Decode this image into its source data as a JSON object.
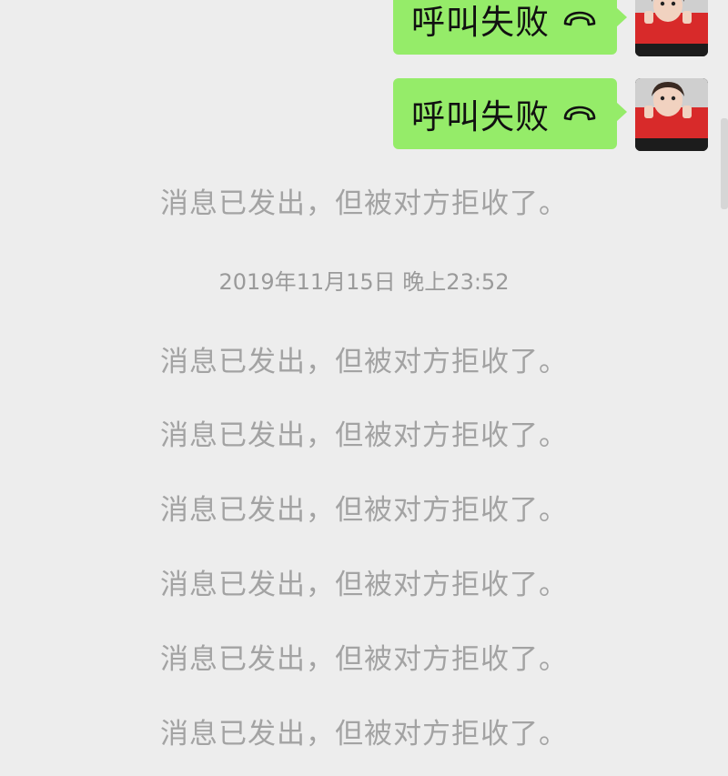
{
  "messages": [
    {
      "text": "呼叫失败",
      "icon": "hangup-phone-icon"
    },
    {
      "text": "呼叫失败",
      "icon": "hangup-phone-icon"
    }
  ],
  "system": {
    "rejected": "消息已发出，但被对方拒收了。",
    "timestamp": "2019年11月15日 晚上23:52"
  },
  "colors": {
    "background": "#ededed",
    "bubble": "#95ec69",
    "system_text": "#a3a3a3"
  }
}
